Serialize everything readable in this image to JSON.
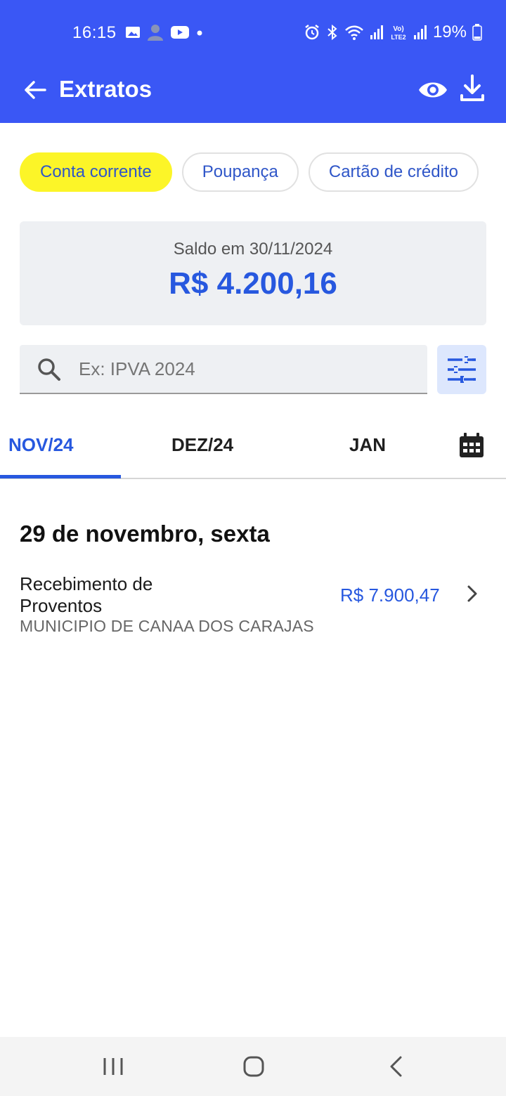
{
  "status_bar": {
    "time": "16:15",
    "battery": "19%"
  },
  "header": {
    "title": "Extratos"
  },
  "chips": [
    {
      "label": "Conta corrente",
      "active": true
    },
    {
      "label": "Poupança",
      "active": false
    },
    {
      "label": "Cartão de crédito",
      "active": false
    }
  ],
  "balance": {
    "label": "Saldo em 30/11/2024",
    "value": "R$ 4.200,16"
  },
  "search": {
    "placeholder": "Ex: IPVA 2024",
    "value": ""
  },
  "tabs": [
    {
      "label": "NOV/24",
      "active": true
    },
    {
      "label": "DEZ/24",
      "active": false
    },
    {
      "label": "JAN",
      "active": false
    }
  ],
  "transactions": {
    "date_heading": "29 de novembro, sexta",
    "items": [
      {
        "description": "Recebimento de Proventos",
        "subtitle": "MUNICIPIO DE CANAA DOS CARAJAS",
        "amount": "R$ 7.900,47"
      }
    ]
  },
  "colors": {
    "brand": "#3a57f5",
    "accent_yellow": "#fcf528",
    "link_blue": "#2758df"
  }
}
